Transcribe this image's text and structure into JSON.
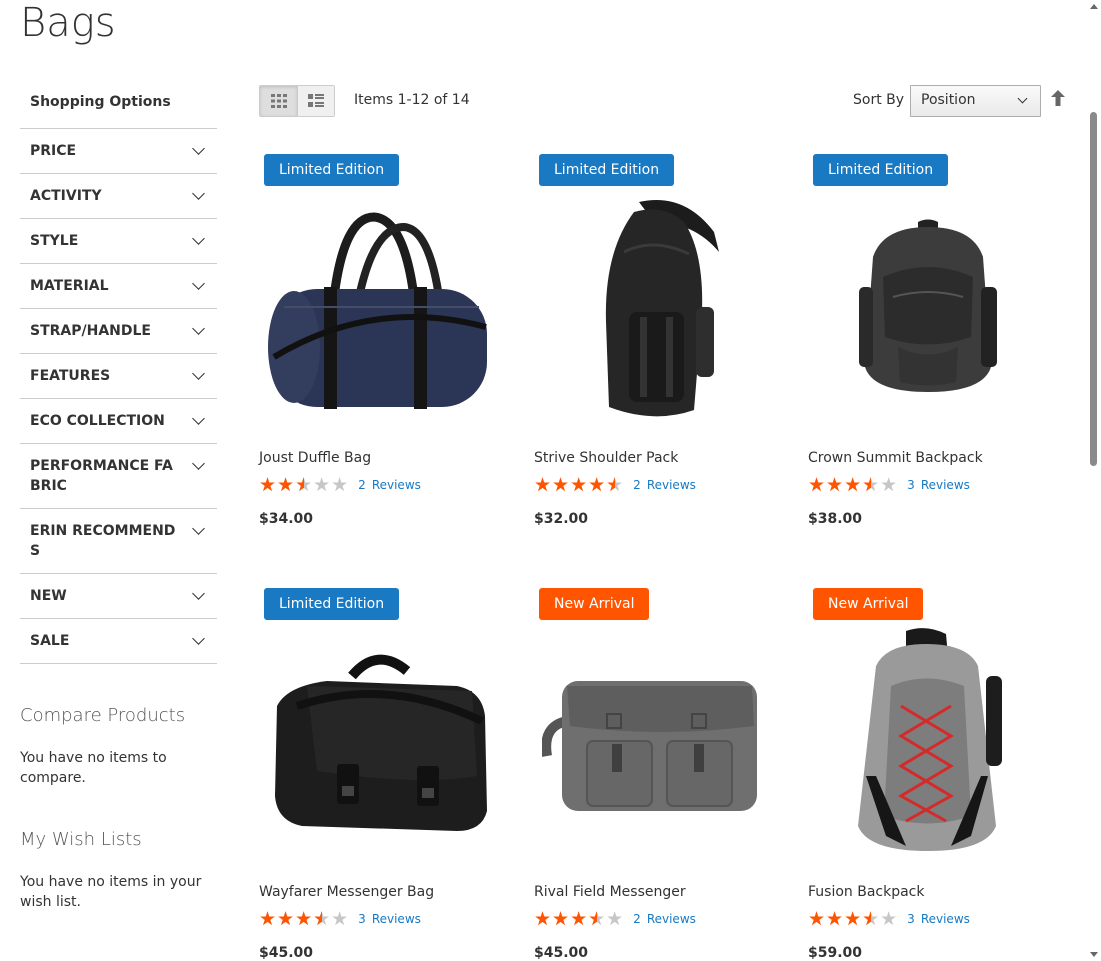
{
  "page": {
    "title": "Bags"
  },
  "sidebar": {
    "title": "Shopping Options",
    "filters": [
      "Price",
      "Activity",
      "Style",
      "Material",
      "Strap/Handle",
      "Features",
      "Eco Collection",
      "Performance Fabric",
      "Erin Recommends",
      "New",
      "Sale"
    ],
    "compare": {
      "title": "Compare Products",
      "text": "You have no items to compare."
    },
    "wishlist": {
      "title": "My Wish Lists",
      "text": "You have no items in your wish list."
    }
  },
  "toolbar": {
    "amount": "Items 1-12 of 14",
    "sort_label": "Sort By",
    "sort_value": "Position",
    "view_mode": "grid"
  },
  "colors": {
    "accent": "#1979c3",
    "new_badge": "#ff5501",
    "star": "#ff5501"
  },
  "products": [
    {
      "name": "Joust Duffle Bag",
      "badge": "Limited Edition",
      "badge_color": "blue",
      "rating": 50,
      "reviews_count": "2",
      "reviews_label": "Reviews",
      "price": "$34.00",
      "icon": "duffle-bag-photo"
    },
    {
      "name": "Strive Shoulder Pack",
      "badge": "Limited Edition",
      "badge_color": "blue",
      "rating": 90,
      "reviews_count": "2",
      "reviews_label": "Reviews",
      "price": "$32.00",
      "icon": "sling-pack-photo"
    },
    {
      "name": "Crown Summit Backpack",
      "badge": "Limited Edition",
      "badge_color": "blue",
      "rating": 70,
      "reviews_count": "3",
      "reviews_label": "Reviews",
      "price": "$38.00",
      "icon": "backpack-photo"
    },
    {
      "name": "Wayfarer Messenger Bag",
      "badge": "Limited Edition",
      "badge_color": "blue",
      "rating": 70,
      "reviews_count": "3",
      "reviews_label": "Reviews",
      "price": "$45.00",
      "icon": "messenger-bag-photo"
    },
    {
      "name": "Rival Field Messenger",
      "badge": "New Arrival",
      "badge_color": "orange",
      "rating": 70,
      "reviews_count": "2",
      "reviews_label": "Reviews",
      "price": "$45.00",
      "icon": "field-messenger-photo"
    },
    {
      "name": "Fusion Backpack",
      "badge": "New Arrival",
      "badge_color": "orange",
      "rating": 70,
      "reviews_count": "3",
      "reviews_label": "Reviews",
      "price": "$59.00",
      "icon": "fusion-backpack-photo"
    }
  ]
}
